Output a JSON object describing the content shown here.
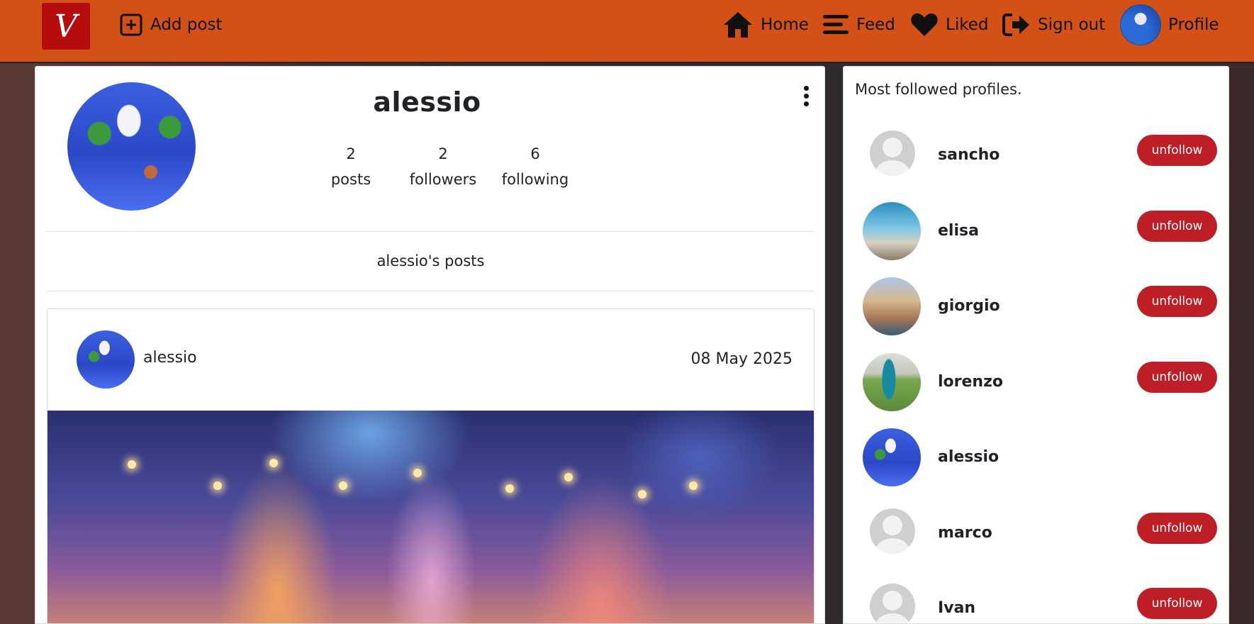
{
  "navbar": {
    "logo_letter": "V",
    "add_post": "Add post",
    "home": "Home",
    "feed": "Feed",
    "liked": "Liked",
    "sign_out": "Sign out",
    "profile": "Profile",
    "accent_color": "#d35016"
  },
  "profile": {
    "username": "alessio",
    "posts_count": "2",
    "posts_label": "posts",
    "followers_count": "2",
    "followers_label": "followers",
    "following_count": "6",
    "following_label": "following",
    "posts_title": "alessio's posts"
  },
  "post": {
    "author": "alessio",
    "date": "08 May 2025"
  },
  "sidebar": {
    "title": "Most followed profiles.",
    "button_label": "unfollow",
    "button_color": "#be1f26",
    "profiles": [
      {
        "name": "sancho"
      },
      {
        "name": "elisa"
      },
      {
        "name": "giorgio"
      },
      {
        "name": "lorenzo"
      },
      {
        "name": "alessio"
      },
      {
        "name": "marco"
      },
      {
        "name": "Ivan"
      }
    ]
  }
}
